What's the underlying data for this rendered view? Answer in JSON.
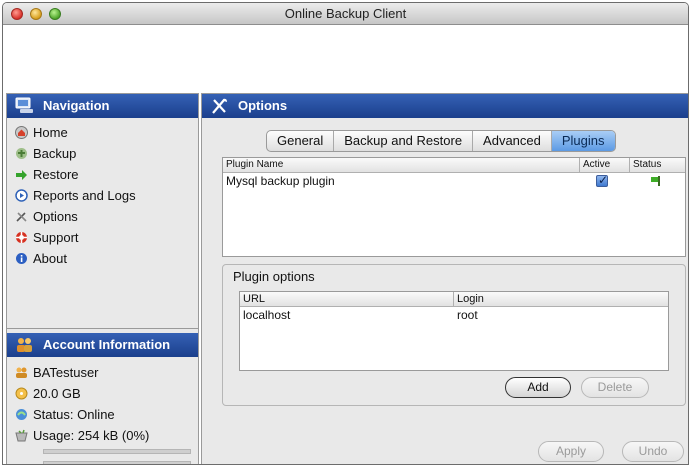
{
  "window": {
    "title": "Online Backup Client"
  },
  "navigation": {
    "header": "Navigation",
    "items": [
      {
        "label": "Home",
        "icon": "home-icon"
      },
      {
        "label": "Backup",
        "icon": "backup-icon"
      },
      {
        "label": "Restore",
        "icon": "restore-icon"
      },
      {
        "label": "Reports and Logs",
        "icon": "reports-icon"
      },
      {
        "label": "Options",
        "icon": "options-icon"
      },
      {
        "label": "Support",
        "icon": "support-icon"
      },
      {
        "label": "About",
        "icon": "about-icon"
      }
    ]
  },
  "account": {
    "header": "Account Information",
    "user": "BATestuser",
    "quota": "20.0 GB",
    "status": "Status: Online",
    "usage": "Usage: 254 kB (0%)",
    "usage_fraction": 0.0
  },
  "options": {
    "header": "Options",
    "tabs": [
      "General",
      "Backup and Restore",
      "Advanced",
      "Plugins"
    ],
    "active_tab": "Plugins",
    "plugin_table": {
      "columns": [
        "Plugin Name",
        "Active",
        "Status"
      ],
      "rows": [
        {
          "name": "Mysql backup plugin",
          "active": true,
          "status": "green"
        }
      ]
    },
    "plugin_options": {
      "legend": "Plugin options",
      "columns": [
        "URL",
        "Login"
      ],
      "rows": [
        {
          "url": "localhost",
          "login": "root"
        }
      ],
      "add_label": "Add",
      "delete_label": "Delete"
    },
    "apply_label": "Apply",
    "undo_label": "Undo"
  },
  "colors": {
    "accent": "#1b3f8c",
    "active_tab": "#5c9ae4",
    "status_ok": "#3fae28"
  }
}
